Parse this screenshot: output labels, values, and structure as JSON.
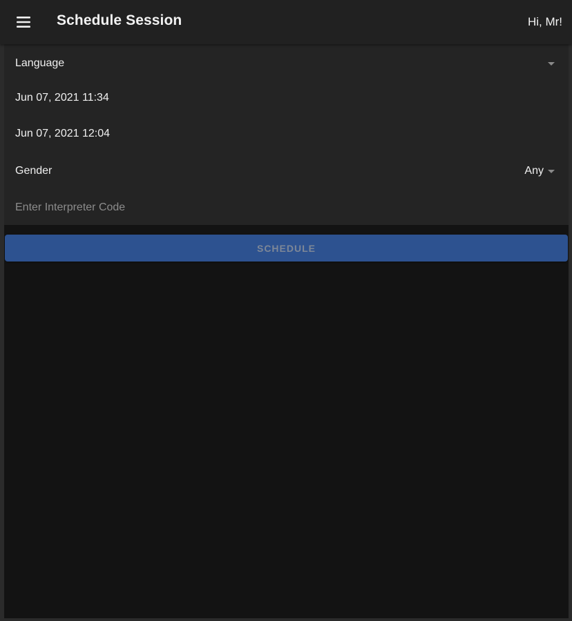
{
  "header": {
    "menu_icon": "hamburger-menu-icon",
    "title": "Schedule Session",
    "greeting": "Hi, Mr!"
  },
  "form": {
    "language": {
      "label": "Language",
      "value": ""
    },
    "start_datetime": "Jun 07, 2021 11:34",
    "end_datetime": "Jun 07, 2021 12:04",
    "gender": {
      "label": "Gender",
      "value": "Any"
    },
    "interpreter_code": {
      "placeholder": "Enter Interpreter Code",
      "value": ""
    }
  },
  "actions": {
    "schedule_label": "SCHEDULE"
  },
  "colors": {
    "header_bg": "#212121",
    "form_bg": "#242424",
    "content_bg": "#131313",
    "button_bg": "#2d5290",
    "button_text": "#7d8797",
    "text_primary": "#f0f0f0",
    "placeholder": "#8c8c8c"
  }
}
